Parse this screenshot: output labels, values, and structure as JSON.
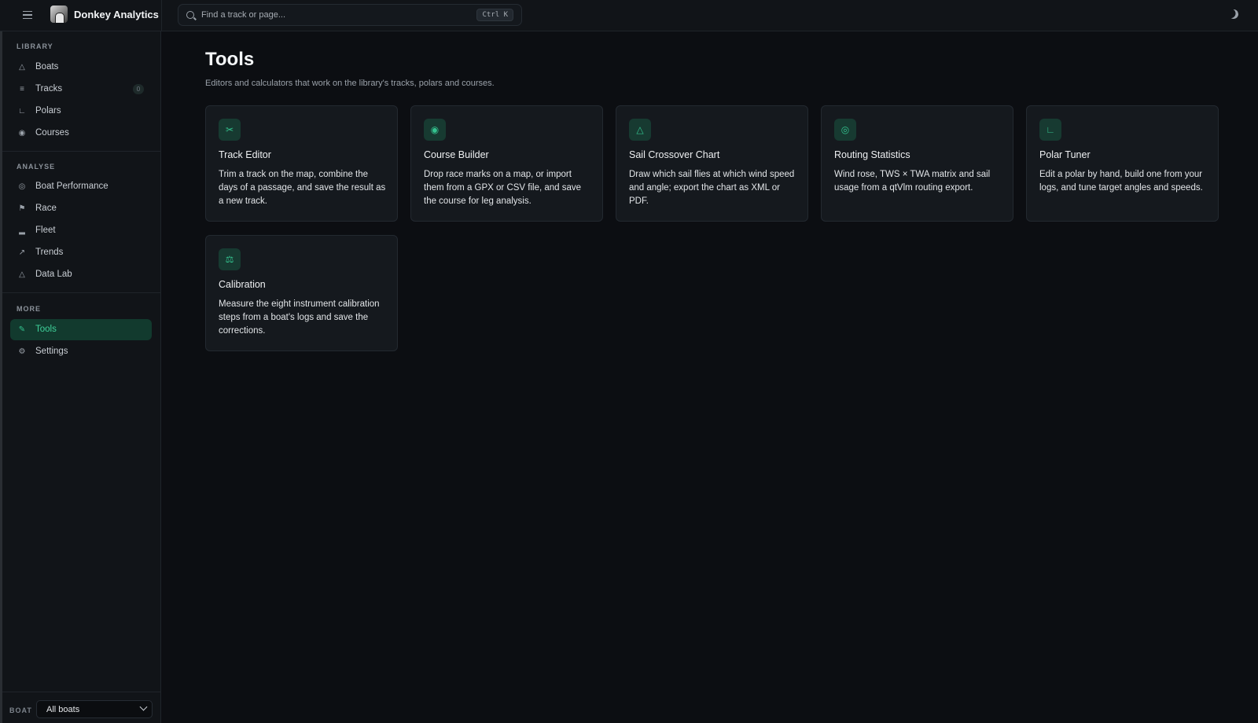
{
  "app": {
    "title": "Donkey Analytics"
  },
  "search": {
    "placeholder": "Find a track or page...",
    "shortcut": "Ctrl K"
  },
  "sidebar": {
    "sections": [
      {
        "label": "LIBRARY",
        "items": [
          {
            "label": "Boats",
            "icon": "sailboat-icon"
          },
          {
            "label": "Tracks",
            "icon": "list-icon",
            "count": "0"
          },
          {
            "label": "Polars",
            "icon": "chart-line-icon"
          },
          {
            "label": "Courses",
            "icon": "map-pin-icon"
          }
        ]
      },
      {
        "label": "ANALYSE",
        "items": [
          {
            "label": "Boat Performance",
            "icon": "gauge-icon"
          },
          {
            "label": "Race",
            "icon": "flag-icon"
          },
          {
            "label": "Fleet",
            "icon": "bar-chart-icon"
          },
          {
            "label": "Trends",
            "icon": "trending-up-icon"
          },
          {
            "label": "Data Lab",
            "icon": "flask-icon"
          }
        ]
      },
      {
        "label": "MORE",
        "items": [
          {
            "label": "Tools",
            "icon": "wrench-icon",
            "active": true
          },
          {
            "label": "Settings",
            "icon": "gear-icon"
          }
        ]
      }
    ],
    "footer": {
      "label": "BOAT",
      "selected": "All boats"
    }
  },
  "main": {
    "title": "Tools",
    "subtitle": "Editors and calculators that work on the library's tracks, polars and courses.",
    "cards": [
      {
        "title": "Track Editor",
        "description": "Trim a track on the map, combine the days of a passage, and save the result as a new track.",
        "icon": "scissors-icon"
      },
      {
        "title": "Course Builder",
        "description": "Drop race marks on a map, or import them from a GPX or CSV file, and save the course for leg analysis.",
        "icon": "map-pin-icon"
      },
      {
        "title": "Sail Crossover Chart",
        "description": "Draw which sail flies at which wind speed and angle; export the chart as XML or PDF.",
        "icon": "sail-icon"
      },
      {
        "title": "Routing Statistics",
        "description": "Wind rose, TWS × TWA matrix and sail usage from a qtVlm routing export.",
        "icon": "compass-icon"
      },
      {
        "title": "Polar Tuner",
        "description": "Edit a polar by hand, build one from your logs, and tune target angles and speeds.",
        "icon": "chart-line-icon"
      },
      {
        "title": "Calibration",
        "description": "Measure the eight instrument calibration steps from a boat's logs and save the corrections.",
        "icon": "scale-icon"
      }
    ]
  },
  "colors": {
    "accent": "#34c38f",
    "background": "#0c0e12",
    "panel": "#111418",
    "card": "#15191e"
  }
}
